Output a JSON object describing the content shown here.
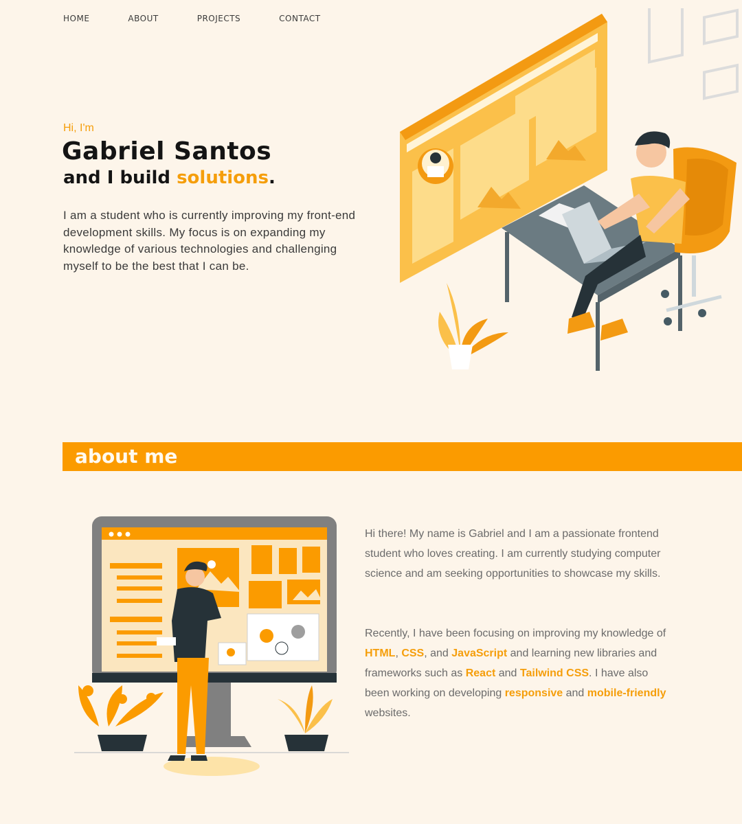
{
  "nav": {
    "items": [
      {
        "label": "HOME"
      },
      {
        "label": "ABOUT"
      },
      {
        "label": "PROJECTS"
      },
      {
        "label": "CONTACT"
      }
    ]
  },
  "hero": {
    "greeting": "Hi, I'm",
    "name": "Gabriel Santos",
    "tagline_prefix": "and I build ",
    "tagline_accent": "solutions",
    "tagline_suffix": ".",
    "intro": "I am a student who is currently improving my front-end development skills. My focus is on expanding my knowledge of various technologies and challenging myself to be the best that I can be."
  },
  "about": {
    "heading": "about me",
    "paragraph1": "Hi there! My name is Gabriel and I am a passionate frontend student who loves creating. I am currently studying computer science and am seeking opportunities to showcase my skills.",
    "p2": {
      "t1": "Recently, I have been focusing on improving my knowledge of ",
      "html": "HTML",
      "t2": ", ",
      "css": "CSS",
      "t3": ", and ",
      "js": "JavaScript",
      "t4": " and learning new libraries and frameworks such as ",
      "react": "React",
      "t5": " and ",
      "tailwind": "Tailwind CSS",
      "t6": ". I have also been working on developing ",
      "responsive": "responsive",
      "t7": " and ",
      "mobile": "mobile-friendly",
      "t8": " websites."
    }
  },
  "icons": {
    "hero_illustration": "developer-at-desk-illustration",
    "about_illustration": "person-at-monitor-illustration"
  },
  "colors": {
    "background": "#fdf5ea",
    "accent": "#f59e0b",
    "banner": "#fb9b00",
    "text_dark": "#141414"
  }
}
